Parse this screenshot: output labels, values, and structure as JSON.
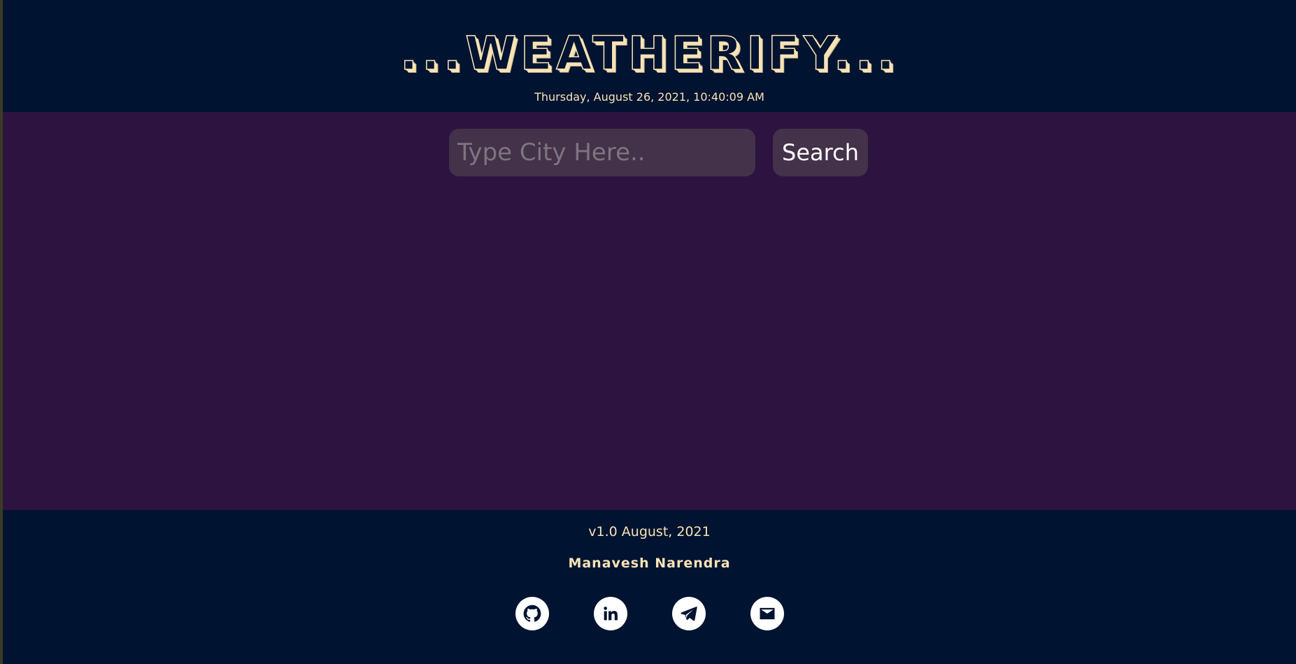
{
  "header": {
    "title": "...WEATHERIFY...",
    "datetime": "Thursday, August 26, 2021, 10:40:09 AM"
  },
  "search": {
    "placeholder": "Type City Here..",
    "value": "",
    "button_label": "Search"
  },
  "footer": {
    "version": "v1.0 August, 2021",
    "author": "Manavesh Narendra",
    "social_icons": [
      "github-icon",
      "linkedin-icon",
      "telegram-icon",
      "email-icon"
    ]
  },
  "colors": {
    "header_bg": "#001330",
    "main_bg": "#2c1340",
    "accent_text": "#f8e3b6",
    "input_bg": "#433249"
  }
}
